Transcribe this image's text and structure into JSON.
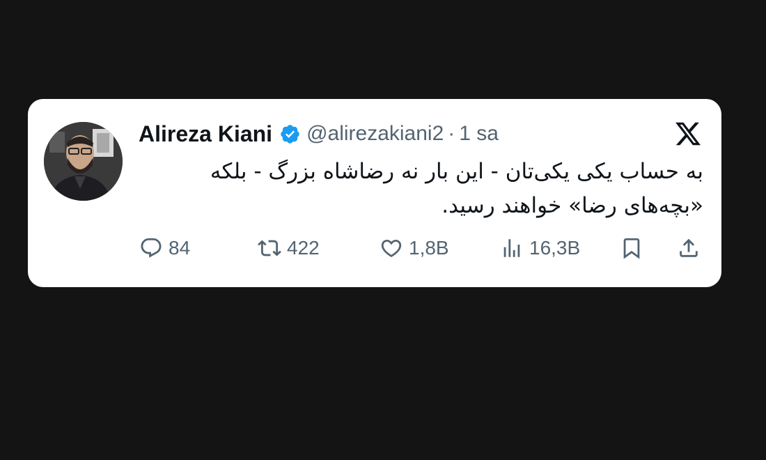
{
  "tweet": {
    "author_name": "Alireza Kiani",
    "handle": "@alirezakiani2",
    "separator": "·",
    "time": "1 sa",
    "text_line1": "به حساب یکی یکی‌تان - این بار نه رضاشاه بزرگ - بلکه",
    "text_line2": "«بچه‌های رضا» خواهند رسید.",
    "verified": true,
    "icons": {
      "avatar": "avatar",
      "verified": "verified-badge-icon",
      "platform": "x-logo-icon"
    }
  },
  "actions": {
    "reply": {
      "icon": "reply-icon",
      "count": "84"
    },
    "repost": {
      "icon": "repost-icon",
      "count": "422"
    },
    "like": {
      "icon": "heart-icon",
      "count": "1,8B"
    },
    "views": {
      "icon": "views-icon",
      "count": "16,3B"
    },
    "bookmark": {
      "icon": "bookmark-icon"
    },
    "share": {
      "icon": "share-icon"
    }
  },
  "colors": {
    "background": "#141414",
    "card": "#ffffff",
    "text": "#0f1419",
    "muted": "#536471",
    "verified": "#1d9bf0"
  }
}
